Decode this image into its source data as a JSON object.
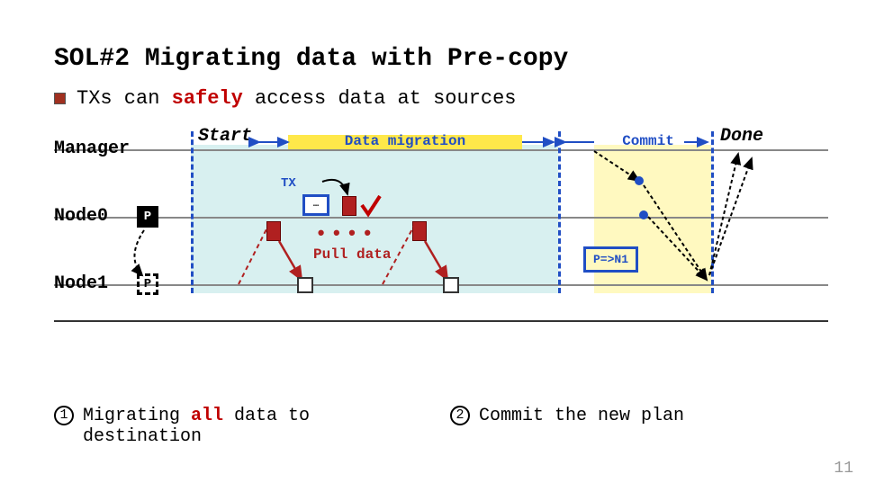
{
  "title": "SOL#2 Migrating data with Pre-copy",
  "bullet": {
    "pre": "TXs can ",
    "em": "safely",
    "post": " access data at sources"
  },
  "labels": {
    "manager": "Manager",
    "node0": "Node0",
    "node1": "Node1",
    "start": "Start",
    "done": "Done",
    "migration": "Data migration",
    "commit": "Commit",
    "pull": "Pull data",
    "tx": "TX",
    "txdots": "…",
    "p": "P",
    "pn1": "P=>N1"
  },
  "steps": {
    "one_pre": "Migrating ",
    "one_em": "all",
    "one_post": " data to destination",
    "two": "Commit the new plan"
  },
  "pagenum": "11"
}
